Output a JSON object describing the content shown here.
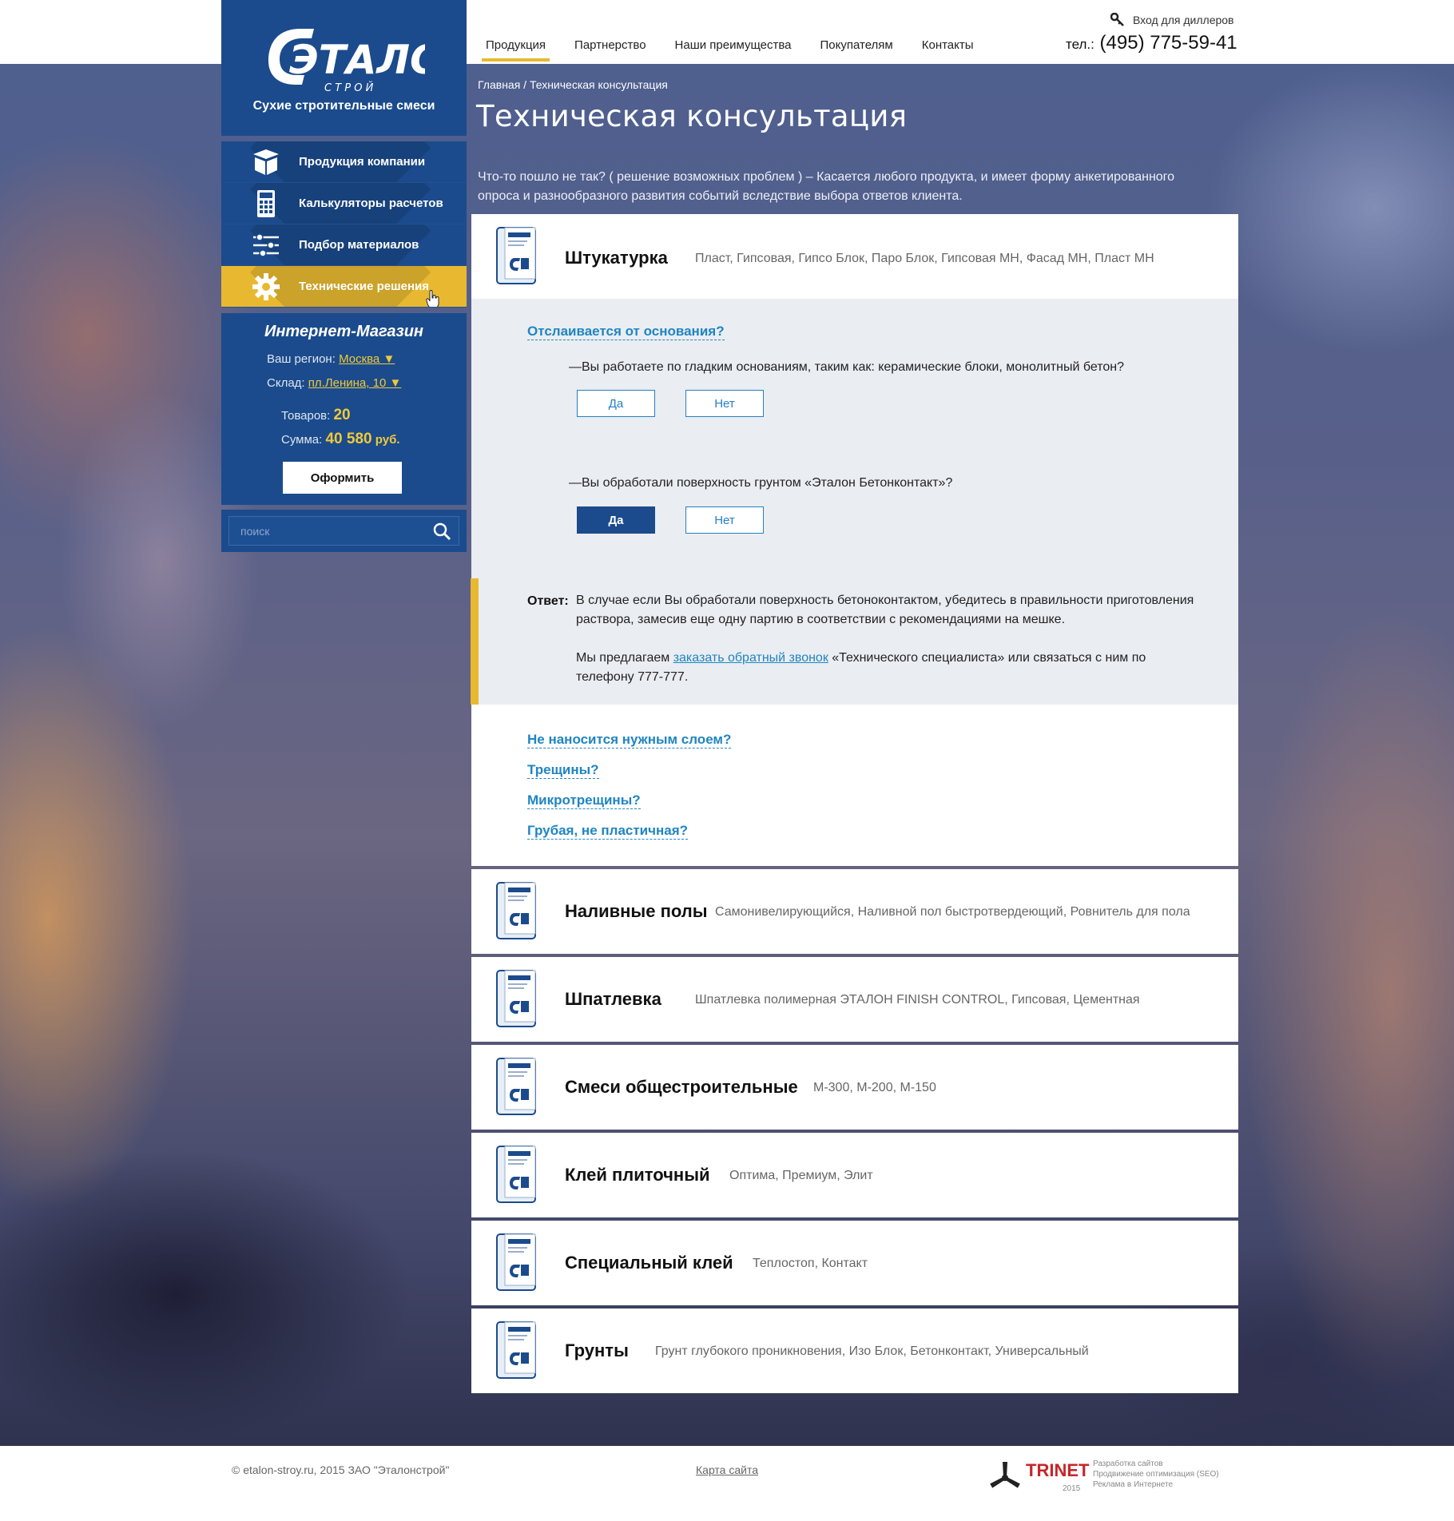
{
  "brand": {
    "logo_text": "ЭТАЛОН",
    "logo_sub": "С Т Р О Й",
    "tagline": "Сухие стротительные смеси"
  },
  "header": {
    "nav": [
      "Продукция",
      "Партнерство",
      "Наши преимущества",
      "Покупателям",
      "Контакты"
    ],
    "dealer_login": "Вход для диллеров",
    "phone_label": "тел.:",
    "phone": "(495) 775-59-41"
  },
  "sidebar": {
    "menu": [
      {
        "label": "Продукция компании",
        "icon": "box-icon"
      },
      {
        "label": "Калькуляторы расчетов",
        "icon": "calculator-icon"
      },
      {
        "label": "Подбор материалов",
        "icon": "sliders-icon"
      },
      {
        "label": "Технические решения",
        "icon": "gear-icon"
      }
    ],
    "shop": {
      "title": "Интернет-Магазин",
      "region_label": "Ваш регион:",
      "region_value": "Москва ▼",
      "store_label": "Склад:",
      "store_value": "пл.Ленина, 10 ▼",
      "items_label": "Товаров:",
      "items_value": "20",
      "sum_label": "Сумма:",
      "sum_value": "40 580",
      "sum_currency": "руб.",
      "order_button": "Оформить"
    },
    "search_placeholder": "поиск"
  },
  "main": {
    "breadcrumb": "Главная / Техническая консультация",
    "title": "Техническая консультация",
    "intro_line1": "Что-то пошло не так? ( решение возможных проблем ) – Касается любого продукта, и имеет форму анкетированного",
    "intro_line2": "опроса и разнообразного развития событий вследствие выбора ответов клиента.",
    "first_product": {
      "name": "Штукатурка",
      "desc": "Пласт, Гипсовая, Гипсо Блок, Паро Блок, Гипсовая МН, Фасад МН, Пласт МН"
    },
    "qa": {
      "question_title": "Отслаивается от основания?",
      "q1": "—Вы работаете по гладким основаниям, таким как: керамические блоки, монолитный бетон?",
      "q2": "—Вы обработали поверхность грунтом «Эталон Бетонконтакт»?",
      "yes": "Да",
      "no": "Нет",
      "answer_label": "Ответ:",
      "answer_l1": "В случае если Вы  обработали поверхность бетоноконтактом, убедитесь в правильности приготовления",
      "answer_l2": "раствора, замесив еще одну партию в соответствии с рекомендациями на мешке.",
      "offer_prefix": "Мы предлагаем ",
      "offer_link": "заказать обратный звонок",
      "offer_suffix": " «Технического специалиста» или связаться с ним по",
      "offer_l2": "телефону 777-777."
    },
    "more_questions": [
      "Не наносится нужным слоем?",
      "Трещины?",
      "Микротрещины?",
      "Грубая, не пластичная?"
    ],
    "products": [
      {
        "name": "Наливные полы",
        "desc": "Самонивелирующийся, Наливной пол быстротвердеющий, Ровнитель для пола"
      },
      {
        "name": "Шпатлевка",
        "desc": "Шпатлевка полимерная ЭТАЛОН FINISH CONTROL, Гипсовая, Цементная"
      },
      {
        "name": "Смеси общестроительные",
        "desc": "М-300, М-200, М-150"
      },
      {
        "name": "Клей плиточный",
        "desc": "Оптима, Премиум, Элит"
      },
      {
        "name": "Специальный клей",
        "desc": "Теплостоп, Контакт"
      },
      {
        "name": "Грунты",
        "desc": "Грунт глубокого проникновения, Изо Блок, Бетонконтакт, Универсальный"
      }
    ]
  },
  "footer": {
    "copyright": "© etalon-stroy.ru, 2015 ЗАО \"Эталонстрой\"",
    "sitemap": "Карта сайта",
    "dev_name": "TRINET",
    "dev_year": "2015",
    "dev_info1": "Разработка сайтов",
    "dev_info2": "Продвижение оптимизация (SEO)",
    "dev_info3": "Реклама в Интернете"
  },
  "colors": {
    "brand_blue": "#1b4b8c",
    "accent_yellow": "#e8b930",
    "link_blue": "#1f85c2"
  }
}
